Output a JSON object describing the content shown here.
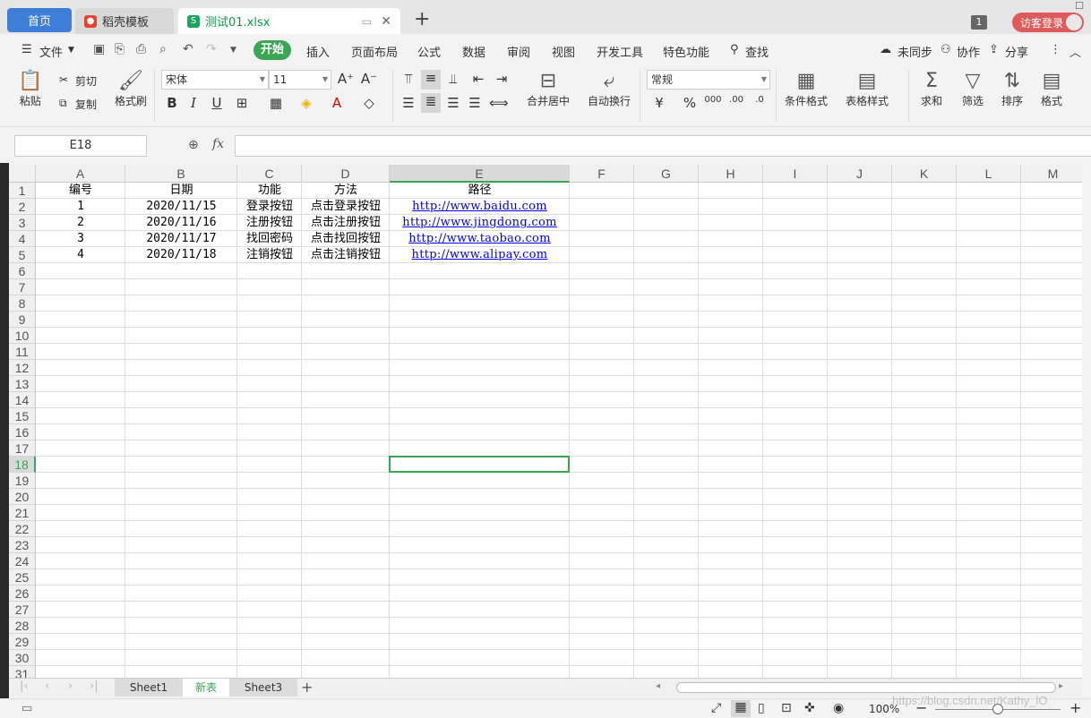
{
  "tabs": {
    "home": "首页",
    "docer": "稻壳模板",
    "file": "测试01.xlsx",
    "add": "+"
  },
  "topright": {
    "count": "1",
    "login": "访客登录"
  },
  "menu": {
    "file": "文件",
    "kaishi": "开始",
    "items": [
      "插入",
      "页面布局",
      "公式",
      "数据",
      "审阅",
      "视图",
      "开发工具",
      "特色功能"
    ],
    "search": "查找",
    "sync": "未同步",
    "collab": "协作",
    "share": "分享"
  },
  "ribbon": {
    "paste": "粘贴",
    "cut": "剪切",
    "copy": "复制",
    "format_painter": "格式刷",
    "font": "宋体",
    "size": "11",
    "merge": "合并居中",
    "wrap": "自动换行",
    "numfmt": "常规",
    "cond": "条件格式",
    "tablestyle": "表格样式",
    "sum": "求和",
    "filter": "筛选",
    "sort": "排序",
    "fmt": "格式"
  },
  "namebox": "E18",
  "fx": "fx",
  "columns": [
    "A",
    "B",
    "C",
    "D",
    "E",
    "F",
    "G",
    "H",
    "I",
    "J",
    "K",
    "L",
    "M"
  ],
  "rows": [
    "1",
    "2",
    "3",
    "4",
    "5",
    "6",
    "7",
    "8",
    "9",
    "10",
    "11",
    "12",
    "13",
    "14",
    "15",
    "16",
    "17",
    "18",
    "19",
    "20",
    "21",
    "22",
    "23",
    "24",
    "25",
    "26",
    "27",
    "28",
    "29",
    "30",
    "31"
  ],
  "table": [
    [
      "编号",
      "日期",
      "功能",
      "方法",
      "路径"
    ],
    [
      "1",
      "2020/11/15",
      "登录按钮",
      "点击登录按钮",
      "http://www.baidu.com"
    ],
    [
      "2",
      "2020/11/16",
      "注册按钮",
      "点击注册按钮",
      "http://www.jingdong.com"
    ],
    [
      "3",
      "2020/11/17",
      "找回密码",
      "点击找回按钮",
      "http://www.taobao.com"
    ],
    [
      "4",
      "2020/11/18",
      "注销按钮",
      "点击注销按钮",
      "http://www.alipay.com"
    ]
  ],
  "sheets": [
    "Sheet1",
    "新表",
    "Sheet3"
  ],
  "status": {
    "zoom": "100%",
    "watermark": "https://blog.csdn.net/Kathy_lO"
  },
  "colors": {
    "accent": "#3aa655",
    "home_tab": "#3e7ed9",
    "login": "#dd5b5b",
    "link": "#0000ee"
  }
}
